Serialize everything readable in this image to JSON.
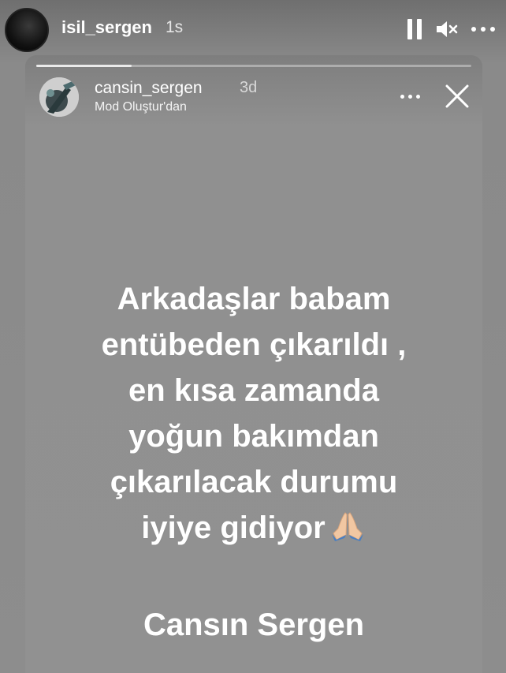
{
  "top_bar": {
    "username": "isil_sergen",
    "time": "1s",
    "icons": [
      "pause-icon",
      "mute-icon",
      "more-options-icon"
    ]
  },
  "shared_story": {
    "progress": 0.22,
    "username": "cansin_sergen",
    "time": "3d",
    "subtitle": "Mod Oluştur'dan",
    "icons": [
      "more-options-icon",
      "close-icon"
    ],
    "text_lines": [
      "Arkadaşlar babam",
      "entübeden çıkarıldı ,",
      "en kısa zamanda",
      "yoğun bakımdan",
      "çıkarılacak durumu",
      "iyiye gidiyor"
    ],
    "emoji": "🙏",
    "signature": "Cansın Sergen"
  },
  "colors": {
    "background": "#8d8d8d",
    "text": "#ffffff"
  }
}
